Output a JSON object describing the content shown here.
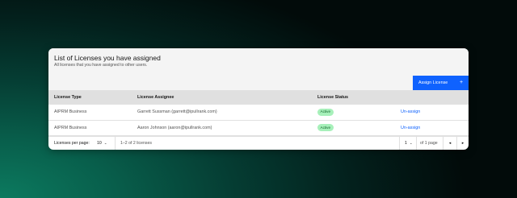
{
  "header": {
    "title": "List of Licenses you have assigned",
    "subtitle": "All licenses that you have assigned to other users.",
    "assign_button": {
      "label": "Assign License",
      "icon": "+"
    }
  },
  "table": {
    "columns": [
      "License Type",
      "License Assignee",
      "License Status",
      ""
    ],
    "rows": [
      {
        "type": "AIPRM Business",
        "assignee": "Garrett Sussman (garrett@ipullrank.com)",
        "status": "Active",
        "action": "Un-assign"
      },
      {
        "type": "AIPRM Business",
        "assignee": "Aaron Johnson (aaron@ipullrank.com)",
        "status": "Active",
        "action": "Un-assign"
      }
    ]
  },
  "pagination": {
    "per_page_label": "Licenses per page:",
    "per_page_value": "10",
    "range_text": "1–2 of 2 licenses",
    "page_value": "1",
    "page_total_text": "of 1 page",
    "prev_icon": "◂",
    "next_icon": "▸",
    "chevron_icon": "⌄"
  },
  "colors": {
    "accent": "#0f62fe",
    "badge_bg": "#a7f0ba",
    "badge_text": "#0e6027",
    "header_bg": "#f4f4f4",
    "table_head_bg": "#e0e0e0"
  }
}
